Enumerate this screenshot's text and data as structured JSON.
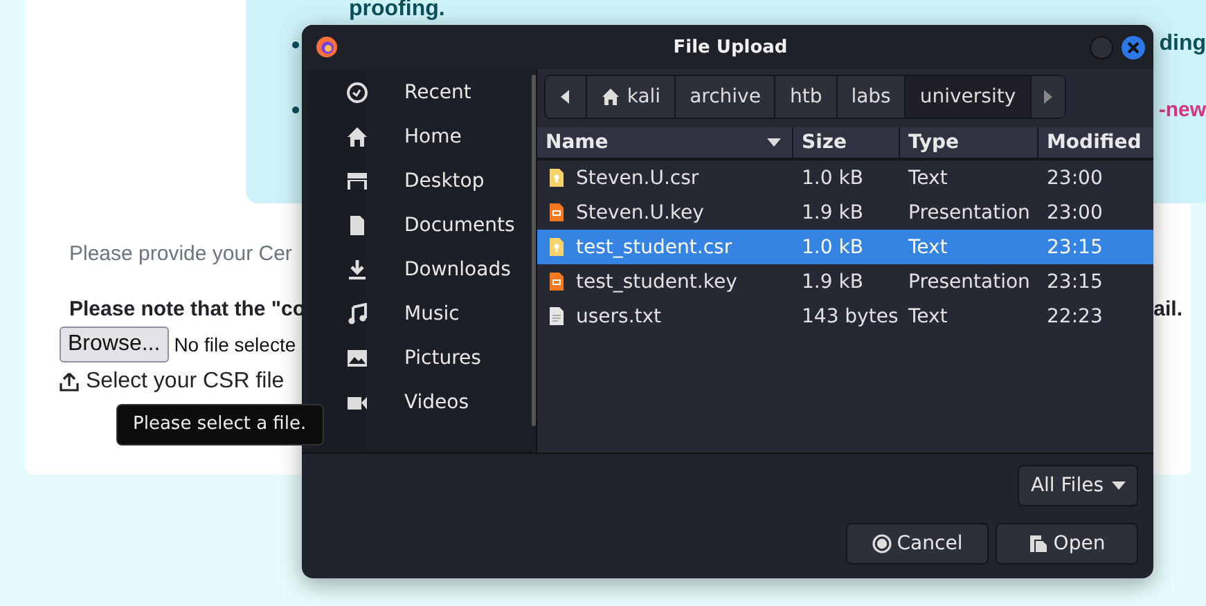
{
  "page": {
    "info_box": {
      "heading": "proofing.",
      "bullets": [
        {
          "kind": "text",
          "text": "ding"
        },
        {
          "kind": "tag",
          "text": "-new"
        }
      ]
    },
    "prompt": "Please provide your Cer",
    "note_start": "Please note that the \"co",
    "note_end": "ail.",
    "browse_button": "Browse...",
    "file_status": "No file selecte",
    "upload_label": "Select your CSR file",
    "tooltip": "Please select a file."
  },
  "dialog": {
    "title": "File Upload",
    "sidebar": {
      "items": [
        {
          "label": "Recent"
        },
        {
          "label": "Home"
        },
        {
          "label": "Desktop"
        },
        {
          "label": "Documents"
        },
        {
          "label": "Downloads"
        },
        {
          "label": "Music"
        },
        {
          "label": "Pictures"
        },
        {
          "label": "Videos"
        }
      ]
    },
    "path": [
      {
        "label": "kali",
        "selected": false
      },
      {
        "label": "archive",
        "selected": false
      },
      {
        "label": "htb",
        "selected": false
      },
      {
        "label": "labs",
        "selected": false
      },
      {
        "label": "university",
        "selected": true
      }
    ],
    "columns": [
      "Name",
      "Size",
      "Type",
      "Modified"
    ],
    "files": [
      {
        "kind": "certificate",
        "name": "Steven.U.csr",
        "size": "1.0 kB",
        "type": "Text",
        "modified": "23:00",
        "selected": false
      },
      {
        "kind": "presentation",
        "name": "Steven.U.key",
        "size": "1.9 kB",
        "type": "Presentation",
        "modified": "23:00",
        "selected": false
      },
      {
        "kind": "certificate",
        "name": "test_student.csr",
        "size": "1.0 kB",
        "type": "Text",
        "modified": "23:15",
        "selected": true
      },
      {
        "kind": "presentation",
        "name": "test_student.key",
        "size": "1.9 kB",
        "type": "Presentation",
        "modified": "23:15",
        "selected": false
      },
      {
        "kind": "plain",
        "name": "users.txt",
        "size": "143 bytes",
        "type": "Text",
        "modified": "22:23",
        "selected": false
      }
    ],
    "filter": "All Files",
    "buttons": [
      {
        "kind": "cancel",
        "label": "Cancel"
      },
      {
        "kind": "open",
        "label": "Open"
      }
    ]
  }
}
